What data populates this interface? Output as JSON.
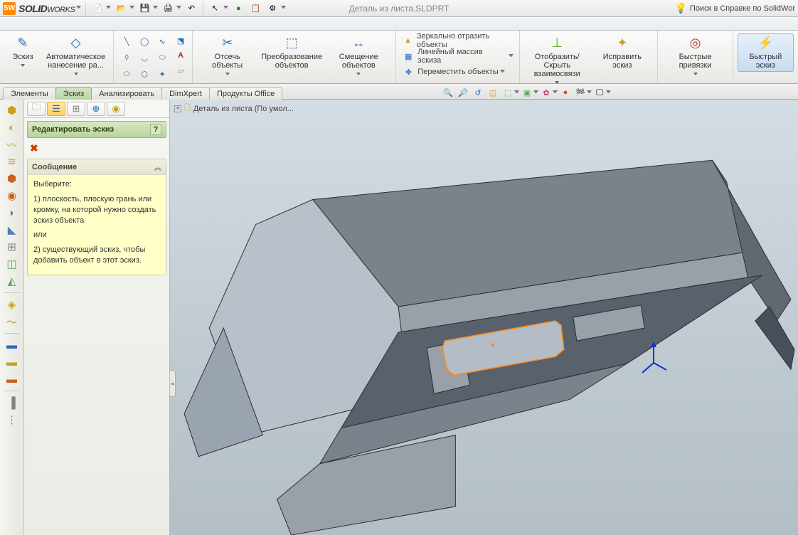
{
  "app": {
    "name": "SOLIDWORKS",
    "doc_title": "Деталь из листа.SLDPRT",
    "help_search": "Поиск в Справке по SolidWor"
  },
  "ribbon": {
    "sketch": "Эскиз",
    "auto_dim": "Автоматическое нанесение ра...",
    "trim": "Отсечь объекты",
    "convert": "Преобразование объектов",
    "offset": "Смещение объектов",
    "mirror": "Зеркально отразить объекты",
    "linear": "Линейный массив эскиза",
    "move": "Переместить объекты",
    "display": "Отобразить/Скрыть взаимосвязи",
    "repair": "Исправить эскиз",
    "quick_snaps": "Быстрые привязки",
    "rapid": "Быстрый эскиз"
  },
  "tabs": {
    "t1": "Элементы",
    "t2": "Эскиз",
    "t3": "Анализировать",
    "t4": "DimXpert",
    "t5": "Продукты Office"
  },
  "crumb": "Деталь из листа  (По умол...",
  "panel": {
    "title": "Редактировать эскиз",
    "msg_head": "Сообщение",
    "msg1": "Выберите:",
    "msg2": "1) плоскость, плоскую грань или кромку, на которой нужно создать эскиз объекта",
    "msg3": "или",
    "msg4": "2) существующий эскиз, чтобы добавить объект в этот эскиз."
  }
}
